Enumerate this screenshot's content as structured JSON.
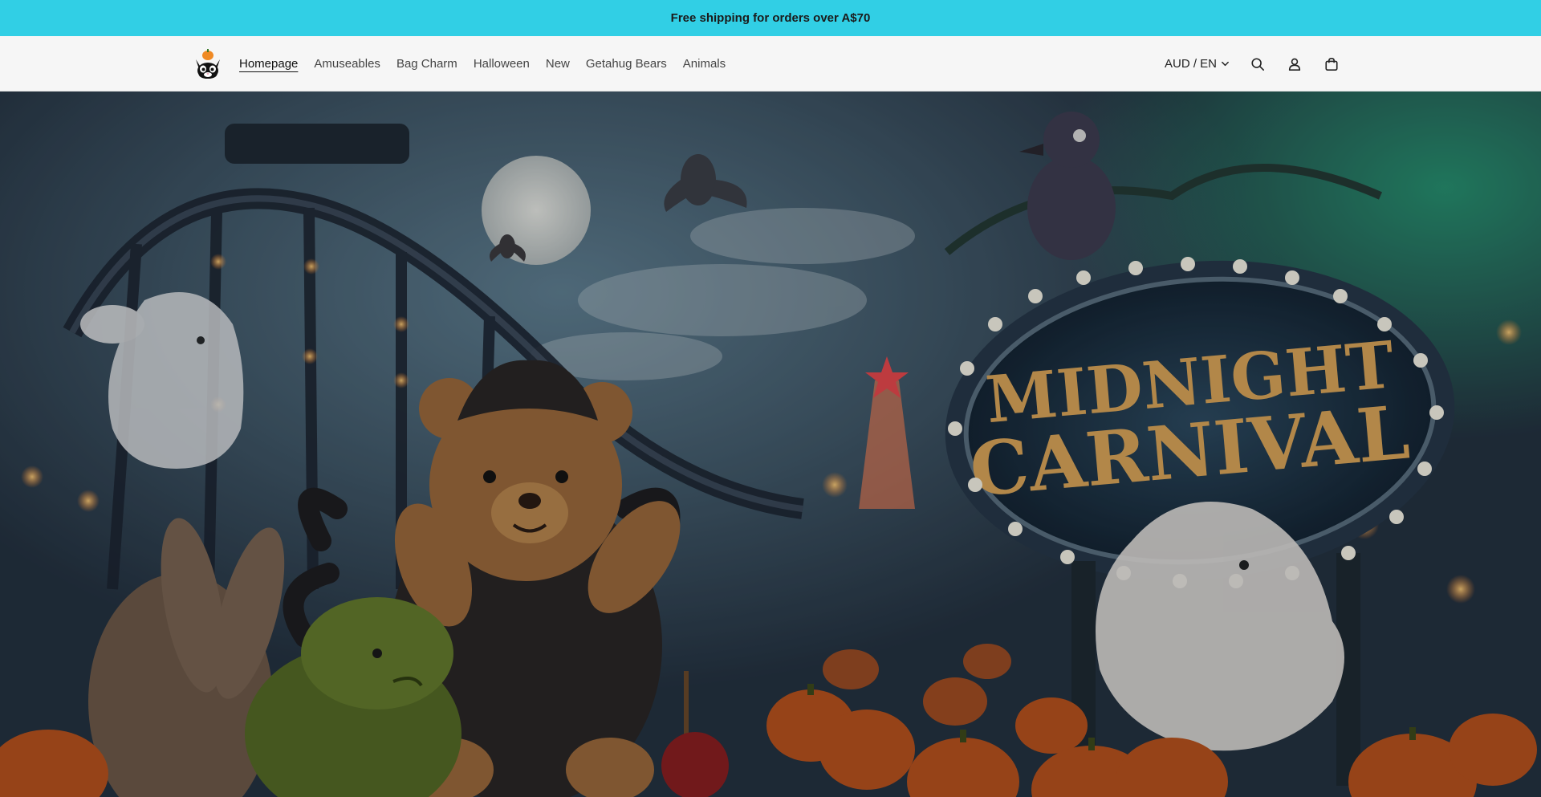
{
  "announcement": {
    "text": "Free shipping for orders over A$70"
  },
  "header": {
    "logo_icon": "cat-pumpkin-logo-icon",
    "nav": [
      {
        "label": "Homepage",
        "active": true
      },
      {
        "label": "Amuseables"
      },
      {
        "label": "Bag Charm"
      },
      {
        "label": "Halloween"
      },
      {
        "label": "New"
      },
      {
        "label": "Getahug Bears"
      },
      {
        "label": "Animals"
      }
    ],
    "locale": {
      "label": "AUD / EN"
    },
    "icons": [
      "search-icon",
      "account-icon",
      "cart-icon"
    ]
  },
  "hero": {
    "sign_line1": "MIDNIGHT",
    "sign_line2": "CARNIVAL"
  },
  "colors": {
    "announcement_bg": "#31cfe5",
    "header_bg": "#f6f6f6",
    "sign_gold": "#e0a94c"
  }
}
